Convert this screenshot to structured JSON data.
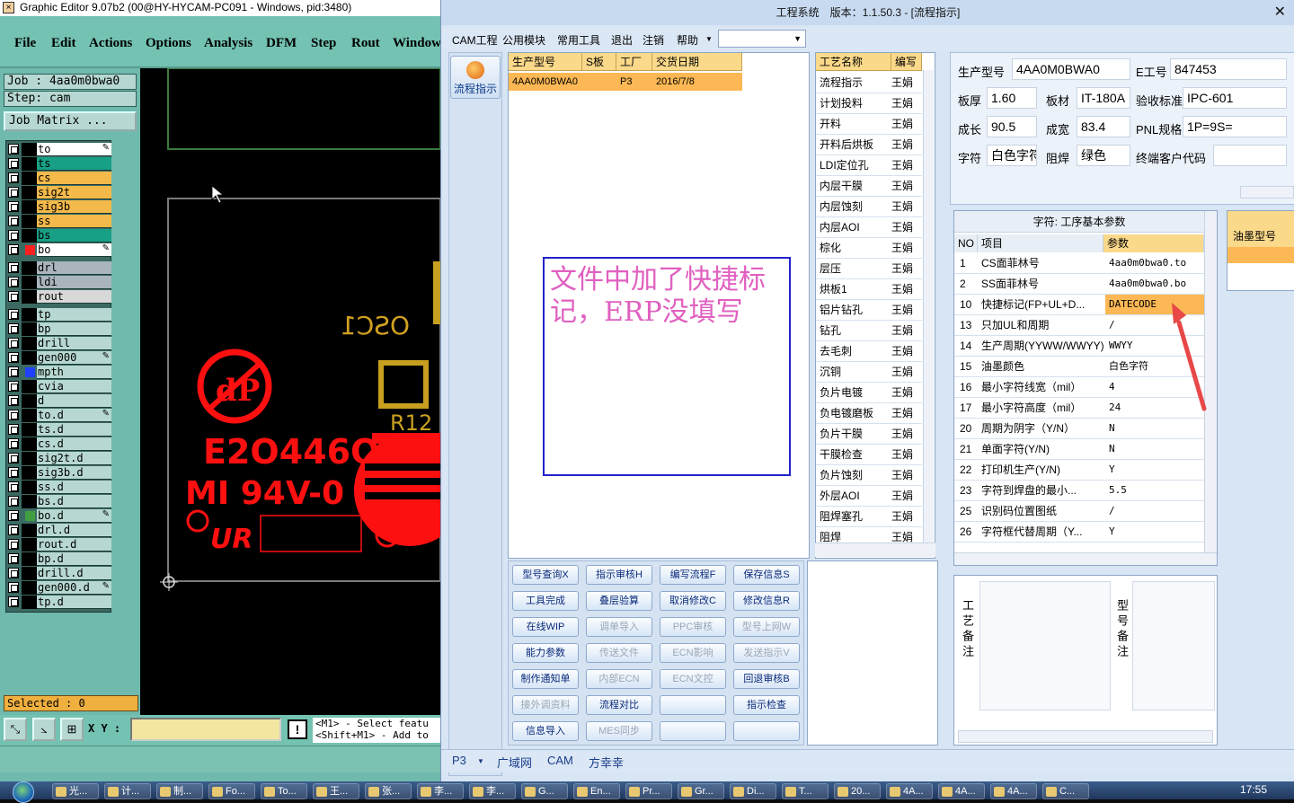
{
  "genesis": {
    "title": "Graphic Editor 9.07b2 (00@HY-HYCAM-PC091 - Windows, pid:3480)",
    "menu": [
      "File",
      "Edit",
      "Actions",
      "Options",
      "Analysis",
      "DFM",
      "Step",
      "Rout",
      "Window"
    ],
    "job_line": "Job : 4aa0m0bwa0",
    "step_line": "Step: cam",
    "job_matrix": "Job Matrix ...",
    "layers": [
      {
        "name": "to",
        "color": "#ffffff",
        "edit": true
      },
      {
        "name": "ts",
        "color": "#17a085"
      },
      {
        "name": "cs",
        "color": "#f3b94a"
      },
      {
        "name": "sig2t",
        "color": "#f3b94a"
      },
      {
        "name": "sig3b",
        "color": "#f3b94a"
      },
      {
        "name": "ss",
        "color": "#f3b94a"
      },
      {
        "name": "bs",
        "color": "#17a085"
      },
      {
        "name": "bo",
        "color": "#ffffff",
        "swatch": "#ff2020",
        "edit": true
      },
      {
        "name": "drl",
        "color": "#a9b4bc"
      },
      {
        "name": "ldi",
        "color": "#a9b4bc"
      },
      {
        "name": "rout",
        "color": "#d8d8d8"
      },
      {
        "name": "tp",
        "color": "#b7d8d2"
      },
      {
        "name": "bp",
        "color": "#b7d8d2"
      },
      {
        "name": "drill",
        "color": "#b7d8d2"
      },
      {
        "name": "gen000",
        "color": "#b7d8d2",
        "edit": true
      },
      {
        "name": "mpth",
        "color": "#b7d8d2",
        "swatch": "#2040ff"
      },
      {
        "name": "cvia",
        "color": "#b7d8d2"
      },
      {
        "name": "d",
        "color": "#b7d8d2"
      },
      {
        "name": "to.d",
        "color": "#b7d8d2",
        "edit": true
      },
      {
        "name": "ts.d",
        "color": "#b7d8d2"
      },
      {
        "name": "cs.d",
        "color": "#b7d8d2"
      },
      {
        "name": "sig2t.d",
        "color": "#b7d8d2"
      },
      {
        "name": "sig3b.d",
        "color": "#b7d8d2"
      },
      {
        "name": "ss.d",
        "color": "#b7d8d2"
      },
      {
        "name": "bs.d",
        "color": "#b7d8d2"
      },
      {
        "name": "bo.d",
        "color": "#b7d8d2",
        "swatch": "#40a040",
        "edit": true
      },
      {
        "name": "drl.d",
        "color": "#b7d8d2"
      },
      {
        "name": "rout.d",
        "color": "#b7d8d2"
      },
      {
        "name": "bp.d",
        "color": "#b7d8d2"
      },
      {
        "name": "drill.d",
        "color": "#b7d8d2"
      },
      {
        "name": "gen000.d",
        "color": "#b7d8d2",
        "edit": true
      },
      {
        "name": "tp.d",
        "color": "#b7d8d2"
      }
    ],
    "selected": "Selected : 0",
    "xy_label": "X Y :",
    "hint_line1": "<M1> - Select featu",
    "hint_line2": "<Shift+M1> - Add to",
    "canvas_text": {
      "osc": "OSC1",
      "code": "E2O446O",
      "rating": "MI 94V-0",
      "r12": "R12"
    }
  },
  "erp": {
    "title": "工程系统　版本：1.1.50.3 - [流程指示]",
    "menu": [
      "CAM工程",
      "公用模块",
      "常用工具",
      "退出",
      "注销",
      "帮助"
    ],
    "flow_button": "流程指示",
    "order_grid": {
      "headers": [
        "生产型号",
        "S板",
        "工厂",
        "交货日期"
      ],
      "row": [
        "4AA0M0BWA0",
        "",
        "P3",
        "2016/7/8"
      ]
    },
    "note_text": "文件中加了快捷标记，ERP没填写",
    "process_grid": {
      "headers": [
        "工艺名称",
        "编写"
      ],
      "rows": [
        [
          "流程指示",
          "王娟"
        ],
        [
          "计划投料",
          "王娟"
        ],
        [
          "开料",
          "王娟"
        ],
        [
          "开料后烘板",
          "王娟"
        ],
        [
          "LDI定位孔",
          "王娟"
        ],
        [
          "内层干膜",
          "王娟"
        ],
        [
          "内层蚀刻",
          "王娟"
        ],
        [
          "内层AOI",
          "王娟"
        ],
        [
          "棕化",
          "王娟"
        ],
        [
          "层压",
          "王娟"
        ],
        [
          "烘板1",
          "王娟"
        ],
        [
          "铝片钻孔",
          "王娟"
        ],
        [
          "钻孔",
          "王娟"
        ],
        [
          "去毛刺",
          "王娟"
        ],
        [
          "沉铜",
          "王娟"
        ],
        [
          "负片电镀",
          "王娟"
        ],
        [
          "负电镀磨板",
          "王娟"
        ],
        [
          "负片干膜",
          "王娟"
        ],
        [
          "干膜检查",
          "王娟"
        ],
        [
          "负片蚀刻",
          "王娟"
        ],
        [
          "外层AOI",
          "王娟"
        ],
        [
          "阻焊塞孔",
          "王娟"
        ],
        [
          "阻焊",
          "王娟"
        ]
      ]
    },
    "buttons": [
      {
        "label": "型号查询X",
        "enabled": true
      },
      {
        "label": "指示审核H",
        "enabled": true
      },
      {
        "label": "编写流程F",
        "enabled": true
      },
      {
        "label": "保存信息S",
        "enabled": true
      },
      {
        "label": "工具完成",
        "enabled": true
      },
      {
        "label": "叠层验算",
        "enabled": true
      },
      {
        "label": "取消修改C",
        "enabled": true
      },
      {
        "label": "修改信息R",
        "enabled": true
      },
      {
        "label": "在线WIP",
        "enabled": true
      },
      {
        "label": "调单导入",
        "enabled": false
      },
      {
        "label": "PPC审核",
        "enabled": false
      },
      {
        "label": "型号上网W",
        "enabled": false
      },
      {
        "label": "能力参数",
        "enabled": true
      },
      {
        "label": "传送文件",
        "enabled": false
      },
      {
        "label": "ECN影响",
        "enabled": false
      },
      {
        "label": "发送指示V",
        "enabled": false
      },
      {
        "label": "制作通知单",
        "enabled": true
      },
      {
        "label": "内部ECN",
        "enabled": false
      },
      {
        "label": "ECN文控",
        "enabled": false
      },
      {
        "label": "回退审核B",
        "enabled": true
      },
      {
        "label": "接外调资料",
        "enabled": false
      },
      {
        "label": "流程对比",
        "enabled": true
      },
      {
        "label": "",
        "enabled": true
      },
      {
        "label": "指示检查",
        "enabled": true
      },
      {
        "label": "信息导入",
        "enabled": true
      },
      {
        "label": "MES同步",
        "enabled": false
      },
      {
        "label": "",
        "enabled": true
      },
      {
        "label": "",
        "enabled": true
      }
    ],
    "info": {
      "model_label": "生产型号",
      "model": "4AA0M0BWA0",
      "eno_label": "E工号",
      "eno": "847453",
      "thick_label": "板厚",
      "thick": "1.60",
      "mat_label": "板材",
      "mat": "IT-180A",
      "std_label": "验收标准",
      "std": "IPC-601",
      "len_label": "成长",
      "len": "90.5",
      "wid_label": "成宽",
      "wid": "83.4",
      "pnl_label": "PNL规格",
      "pnl": "1P=9S=",
      "char_label": "字符",
      "char": "白色字符",
      "mask_label": "阻焊",
      "mask": "绿色",
      "cust_label": "终端客户代码",
      "cust": ""
    },
    "params": {
      "title": "字符: 工序基本参数",
      "headers": [
        "NO",
        "项目",
        "参数"
      ],
      "rows": [
        [
          "1",
          "CS面菲林号",
          "4aa0m0bwa0.to"
        ],
        [
          "2",
          "SS面菲林号",
          "4aa0m0bwa0.bo"
        ],
        [
          "10",
          "快捷标记(FP+UL+D...",
          "DATECODE"
        ],
        [
          "13",
          "只加UL和周期",
          "/"
        ],
        [
          "14",
          "生产周期(YYWW/WWYY)",
          "WWYY"
        ],
        [
          "15",
          "油墨颜色",
          "白色字符"
        ],
        [
          "16",
          "最小字符线宽（mil）",
          "4"
        ],
        [
          "17",
          "最小字符高度（mil）",
          "24"
        ],
        [
          "20",
          "周期为阴字（Y/N）",
          "N"
        ],
        [
          "21",
          "单面字符(Y/N)",
          "N"
        ],
        [
          "22",
          "打印机生产(Y/N)",
          "Y"
        ],
        [
          "23",
          "字符到焊盘的最小...",
          "5.5"
        ],
        [
          "25",
          "识别码位置图纸",
          "/"
        ],
        [
          "26",
          "字符框代替周期（Y...",
          "Y"
        ]
      ]
    },
    "oil_label": "油墨型号",
    "memo_label1": "工艺备注",
    "memo_label2": "型号备注",
    "bottom": [
      "P3",
      "广域网",
      "CAM",
      "方幸幸"
    ]
  },
  "taskbar": {
    "items": [
      "光...",
      "计...",
      "制...",
      "Fo...",
      "To...",
      "王...",
      "张...",
      "李...",
      "李...",
      "G...",
      "En...",
      "Pr...",
      "Gr...",
      "Di...",
      "T...",
      "20...",
      "4A...",
      "4A...",
      "4A...",
      "C..."
    ],
    "clock": "17:55"
  }
}
